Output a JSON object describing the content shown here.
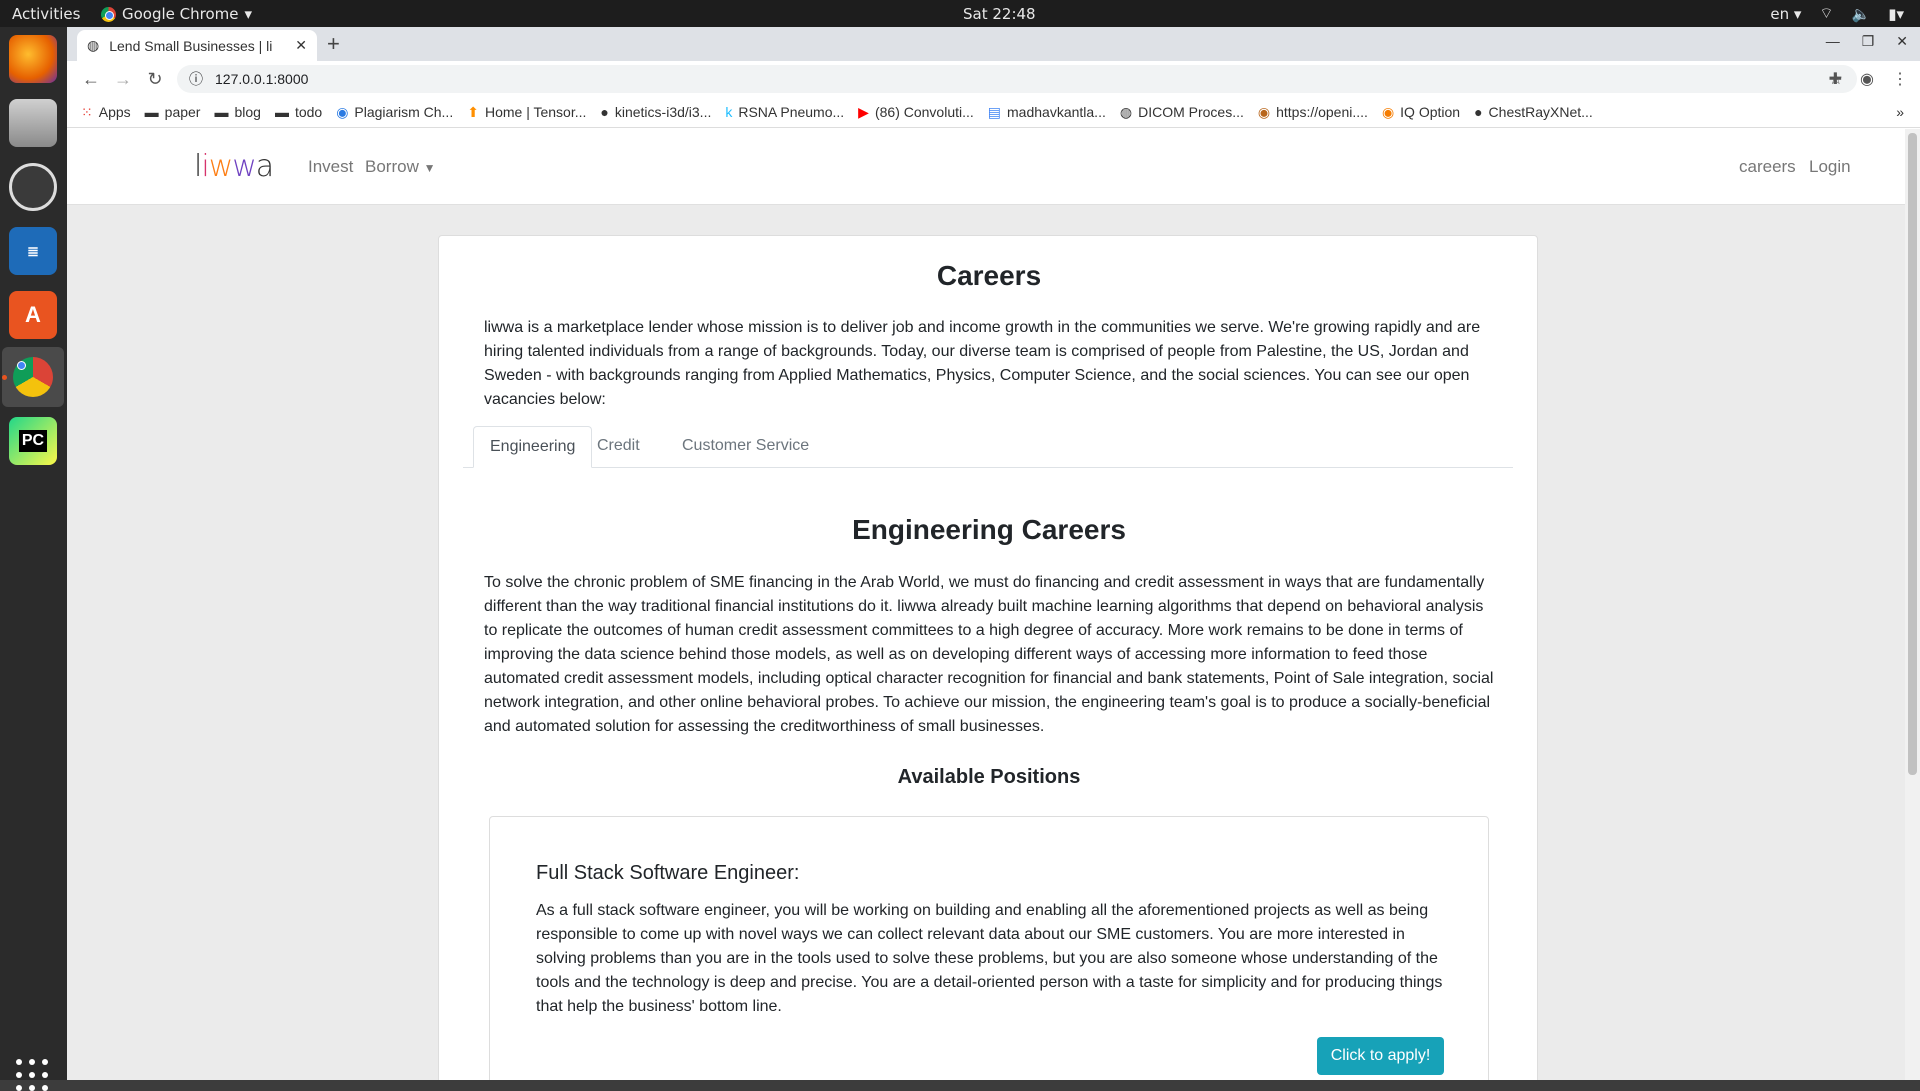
{
  "os": {
    "activities": "Activities",
    "app_name": "Google Chrome",
    "clock": "Sat 22:48",
    "lang": "en"
  },
  "browser": {
    "tab_title": "Lend Small Businesses | li",
    "url": "127.0.0.1:8000",
    "bookmarks": [
      "Apps",
      "paper",
      "blog",
      "todo",
      "Plagiarism Ch...",
      "Home | Tensor...",
      "kinetics-i3d/i3...",
      "RSNA Pneumo...",
      "(86) Convoluti...",
      "madhavkantla...",
      "DICOM Proces...",
      "https://openi....",
      "IQ Option",
      "ChestRayXNet..."
    ]
  },
  "site": {
    "logo": "liwwa",
    "nav": {
      "invest": "Invest",
      "borrow": "Borrow",
      "careers": "careers",
      "login": "Login"
    }
  },
  "careers": {
    "title": "Careers",
    "intro": "liwwa is a marketplace lender whose mission is to deliver job and income growth in the communities we serve. We're growing rapidly and are hiring talented individuals from a range of backgrounds. Today, our diverse team is comprised of people from Palestine, the US, Jordan and Sweden - with backgrounds ranging from Applied Mathematics, Physics, Computer Science, and the social sciences. You can see our open vacancies below:",
    "tabs": [
      "Engineering",
      "Credit",
      "Customer Service"
    ],
    "section_title": "Engineering Careers",
    "section_body": "To solve the chronic problem of SME financing in the Arab World, we must do financing and credit assessment in ways that are fundamentally different than the way traditional financial institutions do it. liwwa already built machine learning algorithms that depend on behavioral analysis to replicate the outcomes of human credit assessment committees to a high degree of accuracy. More work remains to be done in terms of improving the data science behind those models, as well as on developing different ways of accessing more information to feed those automated credit assessment models, including optical character recognition for financial and bank statements, Point of Sale integration, social network integration, and other online behavioral probes. To achieve our mission, the engineering team's goal is to produce a socially-beneficial and automated solution for assessing the creditworthiness of small businesses.",
    "positions_title": "Available Positions",
    "position": {
      "title": "Full Stack Software Engineer:",
      "body": "As a full stack software engineer, you will be working on building and enabling all the aforementioned projects as well as being responsible to come up with novel ways we can collect relevant data about our SME customers. You are more interested in solving problems than you are in the tools used to solve these problems, but you are also someone whose understanding of the tools and the technology is deep and precise. You are a detail-oriented person with a taste for simplicity and for producing things that help the business' bottom line.",
      "apply": "Click to apply!"
    }
  },
  "colors": {
    "accent": "#17a2b8",
    "text": "#212529"
  }
}
